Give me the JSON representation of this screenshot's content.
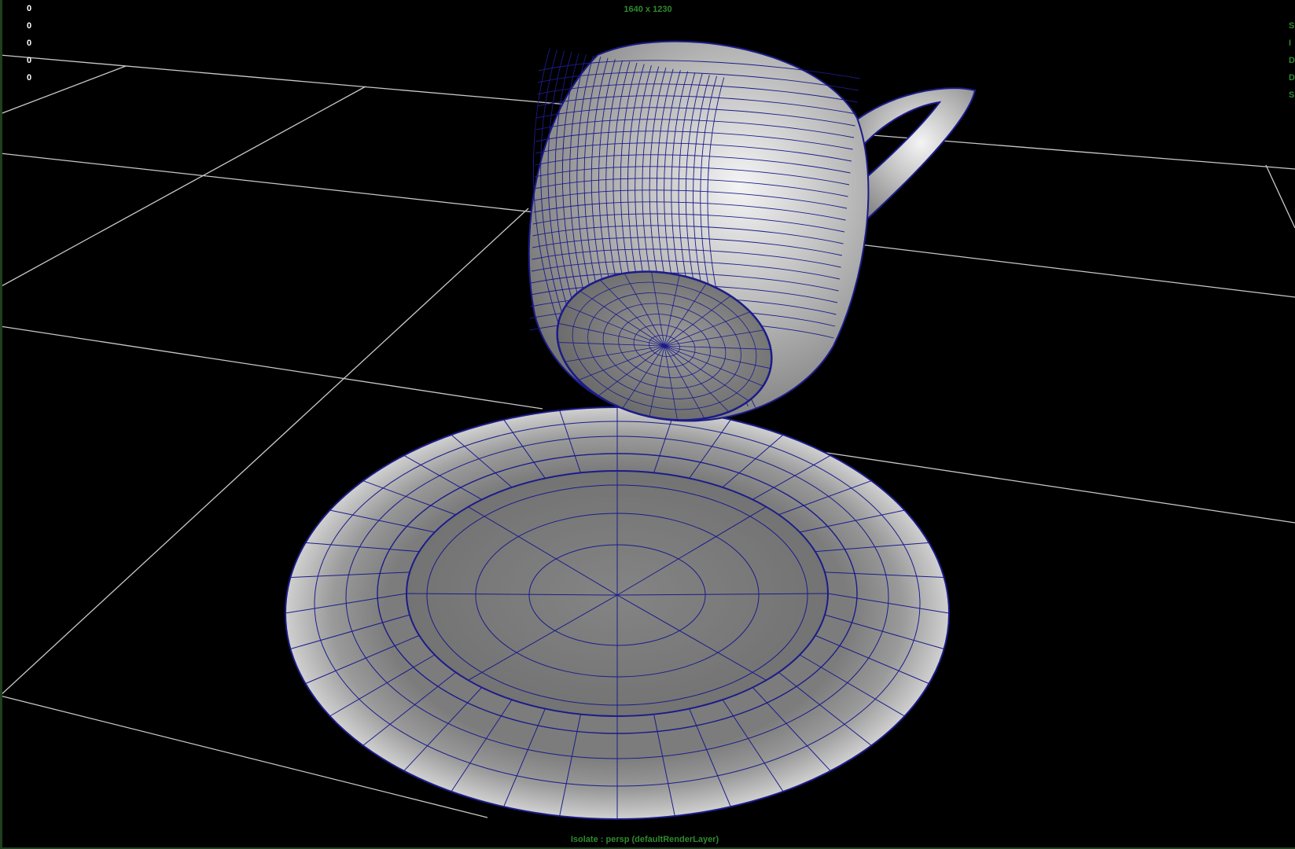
{
  "viewport": {
    "resolution_gate": "1640 x 1230",
    "camera_label": "Isolate : persp (defaultRenderLayer)",
    "hud_stats": [
      "0",
      "0",
      "0",
      "0",
      "0"
    ],
    "right_hud_letters": [
      "S",
      "I",
      "D",
      "D",
      "S"
    ],
    "colors": {
      "background": "#000000",
      "grid": "#c8c8c8",
      "wireframe": "#1b1b8a",
      "hud_text": "#2f8a2f",
      "stat_text": "#ffffff"
    }
  },
  "objects": [
    {
      "name": "cup",
      "shading": "smooth shade with wireframe"
    },
    {
      "name": "saucer",
      "shading": "smooth shade with wireframe"
    }
  ]
}
